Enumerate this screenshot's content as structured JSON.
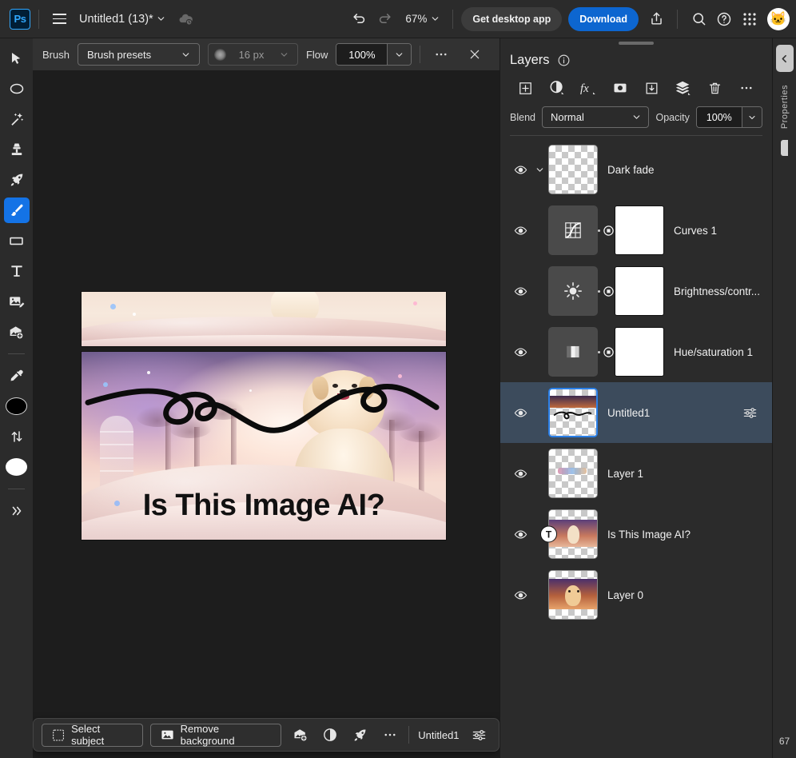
{
  "topbar": {
    "logo_text": "Ps",
    "doc_title": "Untitled1 (13)*",
    "zoom_level": "67%",
    "get_desktop_app": "Get desktop app",
    "download": "Download",
    "avatar_glyph": "🐱"
  },
  "options_bar": {
    "tool_label": "Brush",
    "preset_value": "Brush presets",
    "brush_size": "16 px",
    "flow_label": "Flow",
    "flow_value": "100%"
  },
  "toolbar": {
    "tools": [
      {
        "name": "move-tool",
        "active": false
      },
      {
        "name": "marquee-ellipse-tool",
        "active": false
      },
      {
        "name": "magic-wand-tool",
        "active": false
      },
      {
        "name": "clone-stamp-tool",
        "active": false
      },
      {
        "name": "quick-actions-tool",
        "active": false
      },
      {
        "name": "brush-tool",
        "active": true
      },
      {
        "name": "shape-rectangle-tool",
        "active": false
      },
      {
        "name": "type-tool",
        "active": false
      },
      {
        "name": "edit-image-tool",
        "active": false
      },
      {
        "name": "add-image-tool",
        "active": false
      },
      {
        "name": "eyedropper-tool",
        "active": false
      }
    ],
    "foreground_color": "#000000",
    "background_color": "#ffffff"
  },
  "canvas": {
    "headline": "Is This Image AI?",
    "zoom_badge": "67"
  },
  "taskbar": {
    "select_subject": "Select subject",
    "remove_background": "Remove background",
    "doc_name": "Untitled1"
  },
  "layers_panel": {
    "title": "Layers",
    "blend_label": "Blend",
    "blend_value": "Normal",
    "opacity_label": "Opacity",
    "opacity_value": "100%",
    "accent_selected": "#3c4b5c",
    "accent_thumb_border": "#2b80e8",
    "layers": [
      {
        "name": "Dark fade",
        "type": "group",
        "visible": true,
        "expanded": true,
        "selected": false
      },
      {
        "name": "Curves 1",
        "type": "adjustment",
        "adj_icon": "curves-icon",
        "visible": true,
        "selected": false
      },
      {
        "name": "Brightness/contr...",
        "type": "adjustment",
        "adj_icon": "brightness-icon",
        "visible": true,
        "selected": false
      },
      {
        "name": "Hue/saturation 1",
        "type": "adjustment",
        "adj_icon": "hue-saturation-icon",
        "visible": true,
        "selected": false
      },
      {
        "name": "Untitled1",
        "type": "pixel",
        "visible": true,
        "selected": true
      },
      {
        "name": "Layer 1",
        "type": "pixel",
        "visible": true,
        "selected": false
      },
      {
        "name": "Is This Image AI?",
        "type": "text",
        "visible": true,
        "selected": false
      },
      {
        "name": "Layer 0",
        "type": "pixel",
        "visible": true,
        "selected": false
      }
    ]
  },
  "right_rail": {
    "tab_label": "Properties",
    "bottom_value": "67"
  }
}
